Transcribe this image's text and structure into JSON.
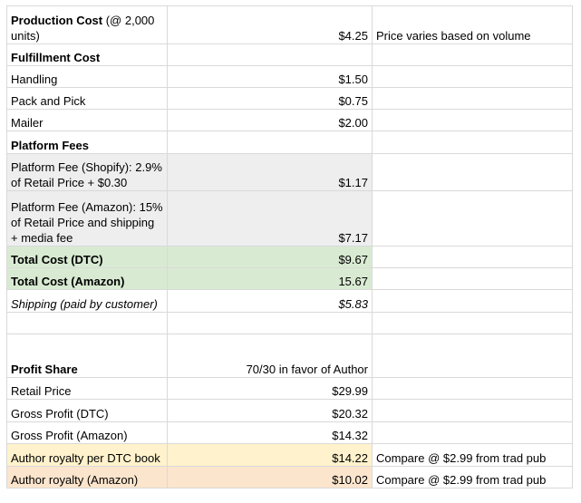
{
  "rows": [
    {
      "label": "Production Cost",
      "label_suffix": " (@ 2,000 units)",
      "value": "$4.25",
      "note": "Price varies based on volume",
      "style": "header-mixed",
      "height": 42
    },
    {
      "label": "Fulfillment Cost",
      "value": "",
      "note": "",
      "style": "bold",
      "height": 24
    },
    {
      "label": "Handling",
      "value": "$1.50",
      "note": "",
      "style": "plain",
      "height": 24
    },
    {
      "label": "Pack and Pick",
      "value": "$0.75",
      "note": "",
      "style": "plain",
      "height": 24
    },
    {
      "label": "Mailer",
      "value": "$2.00",
      "note": "",
      "style": "plain",
      "height": 24
    },
    {
      "label": "Platform Fees",
      "value": "",
      "note": "",
      "style": "bold",
      "height": 25
    },
    {
      "label": "Platform Fee (Shopify): 2.9% of Retail Price + $0.30",
      "value": "$1.17",
      "note": "",
      "style": "plain",
      "bg": "#eeeeee",
      "height": 41
    },
    {
      "label": "Platform Fee (Amazon): 15% of Retail Price and shipping + media fee",
      "value": "$7.17",
      "note": "",
      "style": "plain",
      "bg": "#eeeeee",
      "height": 61
    },
    {
      "label": "Total Cost (DTC)",
      "value": "$9.67",
      "note": "",
      "style": "bold",
      "bg": "#d9ead3",
      "height": 24
    },
    {
      "label": "Total Cost (Amazon)",
      "value": "15.67",
      "note": "",
      "style": "bold",
      "bg": "#d9ead3",
      "height": 24
    },
    {
      "label": "Shipping (paid by customer)",
      "value": "$5.83",
      "note": "",
      "style": "italic",
      "height": 25
    },
    {
      "label": "",
      "value": "",
      "note": "",
      "style": "plain",
      "height": 24
    },
    {
      "label": "Profit Share",
      "value": "70/30 in favor of Author",
      "note": "",
      "style": "bold",
      "height": 48
    },
    {
      "label": "Retail Price",
      "value": "$29.99",
      "note": "",
      "style": "plain",
      "height": 24
    },
    {
      "label": "Gross Profit (DTC)",
      "value": "$20.32",
      "note": "",
      "style": "plain",
      "height": 25
    },
    {
      "label": "Gross Profit (Amazon)",
      "value": "$14.32",
      "note": "",
      "style": "plain",
      "height": 24
    },
    {
      "label": "Author royalty per DTC book",
      "value": "$14.22",
      "note": "Compare @ $2.99 from trad pub",
      "style": "plain",
      "bg": "#fff2cc",
      "height": 25
    },
    {
      "label": "Author royalty (Amazon)",
      "value": "$10.02",
      "note": "Compare @ $2.99 from trad pub",
      "style": "plain",
      "bg": "#fce5cd",
      "height": 24
    }
  ]
}
